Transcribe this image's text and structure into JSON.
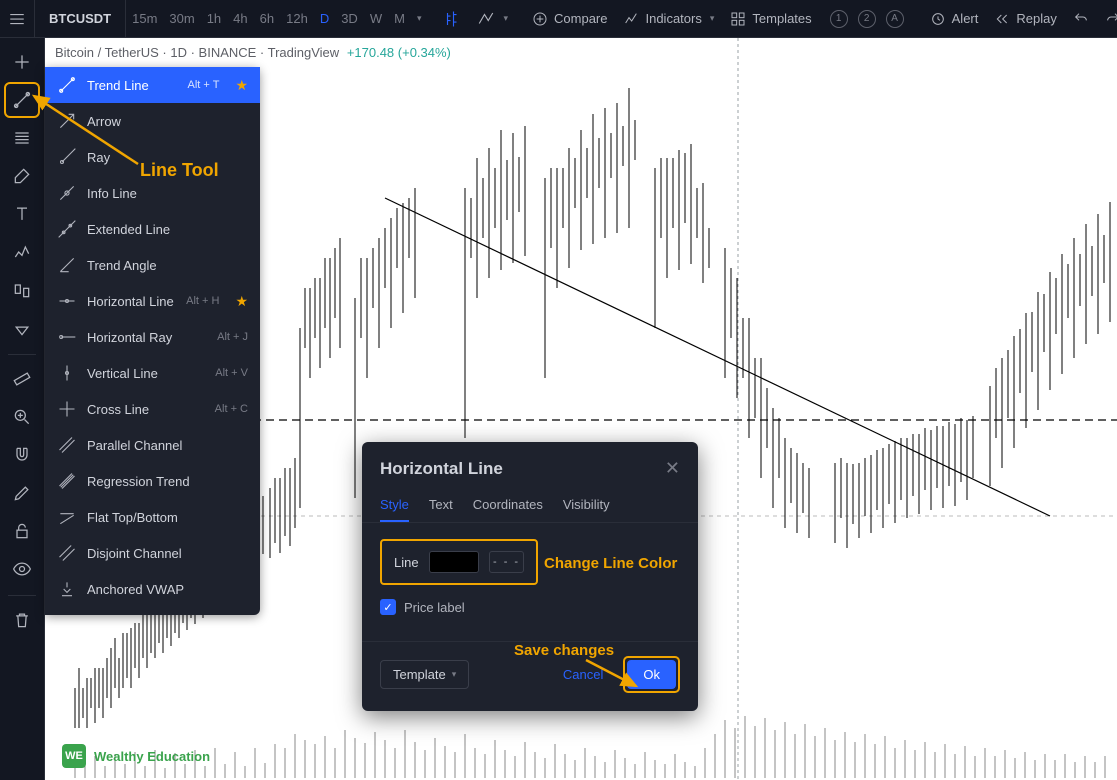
{
  "header": {
    "symbol": "BTCUSDT",
    "intervals": [
      "15m",
      "30m",
      "1h",
      "4h",
      "6h",
      "12h",
      "D",
      "3D",
      "W",
      "M"
    ],
    "active_interval": "D",
    "compare": "Compare",
    "indicators": "Indicators",
    "templates": "Templates",
    "alert": "Alert",
    "replay": "Replay",
    "layouts": [
      "1",
      "2",
      "A"
    ]
  },
  "info": {
    "pair": "Bitcoin / TetherUS · 1D · BINANCE · TradingView",
    "change": "+170.48 (+0.34%)"
  },
  "flyout": {
    "items": [
      {
        "label": "Trend Line",
        "shortcut": "Alt + T",
        "selected": true,
        "starred": true
      },
      {
        "label": "Arrow"
      },
      {
        "label": "Ray"
      },
      {
        "label": "Info Line"
      },
      {
        "label": "Extended Line"
      },
      {
        "label": "Trend Angle"
      },
      {
        "label": "Horizontal Line",
        "shortcut": "Alt + H",
        "starred": true
      },
      {
        "label": "Horizontal Ray",
        "shortcut": "Alt + J"
      },
      {
        "label": "Vertical Line",
        "shortcut": "Alt + V"
      },
      {
        "label": "Cross Line",
        "shortcut": "Alt + C"
      },
      {
        "label": "Parallel Channel"
      },
      {
        "label": "Regression Trend"
      },
      {
        "label": "Flat Top/Bottom"
      },
      {
        "label": "Disjoint Channel"
      },
      {
        "label": "Anchored VWAP"
      }
    ]
  },
  "dialog": {
    "title": "Horizontal Line",
    "tabs": [
      "Style",
      "Text",
      "Coordinates",
      "Visibility"
    ],
    "active_tab": "Style",
    "line_label": "Line",
    "dash_text": "- - -",
    "price_label": "Price label",
    "template": "Template",
    "cancel": "Cancel",
    "ok": "Ok"
  },
  "annotations": {
    "line_tool": "Line Tool",
    "change_color": "Change Line Color",
    "save_changes": "Save changes"
  },
  "brand": {
    "badge": "WE",
    "name": "Wealthy Education"
  }
}
